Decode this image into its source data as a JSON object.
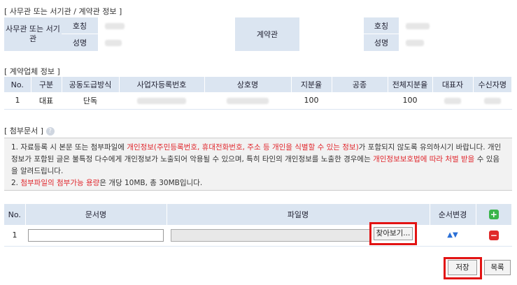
{
  "section1": {
    "title": "[ 사무관 또는 서기관 / 계약관 정보 ]",
    "officer_label": "사무관 또는 서기관",
    "contractor_label": "계약관",
    "position_label": "호칭",
    "name_label": "성명"
  },
  "section2": {
    "title": "[ 계약업체 정보 ]",
    "headers": [
      "No.",
      "구분",
      "공동도급방식",
      "사업자등록번호",
      "상호명",
      "지분율",
      "공종",
      "전체지분율",
      "대표자",
      "수신자명"
    ],
    "row": {
      "no": "1",
      "type": "대표",
      "method": "단독",
      "share": "100",
      "total_share": "100"
    }
  },
  "section3": {
    "title": "[ 첨부문서 ]",
    "help_icon": "help-icon",
    "notice1_a": "1. 자료등록 시 본문 또는 첨부파일에 ",
    "notice1_b": "개인정보(주민등록번호, 휴대전화번호, 주소 등 개인을 식별할 수 있는 정보)",
    "notice1_c": "가 포함되지 않도록 유의하시기 바랍니다. 개인정보가 포함된 글은 불특정 다수에게 개인정보가 노출되어 악용될 수 있으며, 특히 타인의 개인정보를 노출한 경우에는 ",
    "notice1_d": "개인정보보호법에 따라 처벌 받을",
    "notice1_e": " 수 있음을 알려드립니다.",
    "notice2_a": "2. ",
    "notice2_b": "첨부파일의 첨부가능 용량",
    "notice2_c": "은 개당 10MB, 총 30MB입니다."
  },
  "attach": {
    "headers": {
      "no": "No.",
      "doc": "문서명",
      "file": "파일명",
      "order": "순서변경"
    },
    "row_no": "1",
    "browse_label": "찾아보기...",
    "order_arrows": "▲▼"
  },
  "buttons": {
    "save": "저장",
    "list": "목록"
  }
}
